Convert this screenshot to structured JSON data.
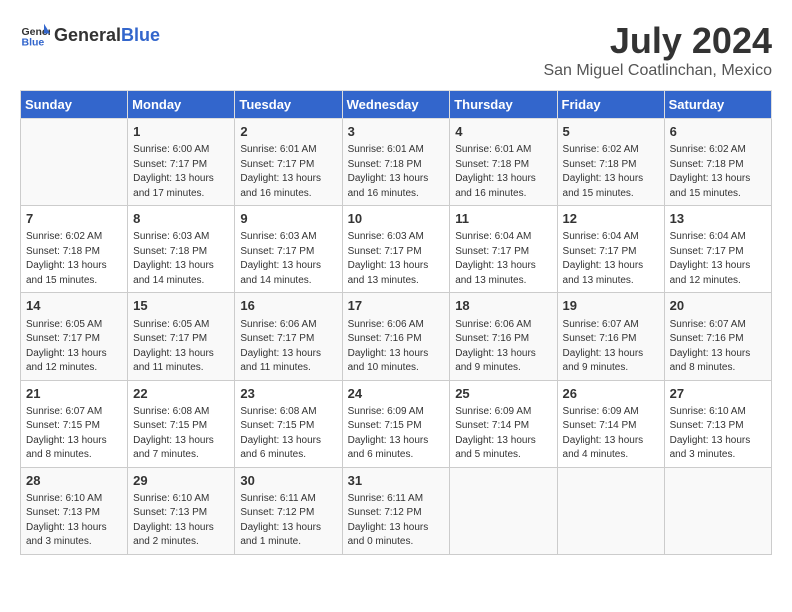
{
  "header": {
    "logo_general": "General",
    "logo_blue": "Blue",
    "title": "July 2024",
    "subtitle": "San Miguel Coatlinchan, Mexico"
  },
  "days_of_week": [
    "Sunday",
    "Monday",
    "Tuesday",
    "Wednesday",
    "Thursday",
    "Friday",
    "Saturday"
  ],
  "weeks": [
    [
      {
        "day": "",
        "sunrise": "",
        "sunset": "",
        "daylight": ""
      },
      {
        "day": "1",
        "sunrise": "Sunrise: 6:00 AM",
        "sunset": "Sunset: 7:17 PM",
        "daylight": "Daylight: 13 hours and 17 minutes."
      },
      {
        "day": "2",
        "sunrise": "Sunrise: 6:01 AM",
        "sunset": "Sunset: 7:17 PM",
        "daylight": "Daylight: 13 hours and 16 minutes."
      },
      {
        "day": "3",
        "sunrise": "Sunrise: 6:01 AM",
        "sunset": "Sunset: 7:18 PM",
        "daylight": "Daylight: 13 hours and 16 minutes."
      },
      {
        "day": "4",
        "sunrise": "Sunrise: 6:01 AM",
        "sunset": "Sunset: 7:18 PM",
        "daylight": "Daylight: 13 hours and 16 minutes."
      },
      {
        "day": "5",
        "sunrise": "Sunrise: 6:02 AM",
        "sunset": "Sunset: 7:18 PM",
        "daylight": "Daylight: 13 hours and 15 minutes."
      },
      {
        "day": "6",
        "sunrise": "Sunrise: 6:02 AM",
        "sunset": "Sunset: 7:18 PM",
        "daylight": "Daylight: 13 hours and 15 minutes."
      }
    ],
    [
      {
        "day": "7",
        "sunrise": "Sunrise: 6:02 AM",
        "sunset": "Sunset: 7:18 PM",
        "daylight": "Daylight: 13 hours and 15 minutes."
      },
      {
        "day": "8",
        "sunrise": "Sunrise: 6:03 AM",
        "sunset": "Sunset: 7:18 PM",
        "daylight": "Daylight: 13 hours and 14 minutes."
      },
      {
        "day": "9",
        "sunrise": "Sunrise: 6:03 AM",
        "sunset": "Sunset: 7:17 PM",
        "daylight": "Daylight: 13 hours and 14 minutes."
      },
      {
        "day": "10",
        "sunrise": "Sunrise: 6:03 AM",
        "sunset": "Sunset: 7:17 PM",
        "daylight": "Daylight: 13 hours and 13 minutes."
      },
      {
        "day": "11",
        "sunrise": "Sunrise: 6:04 AM",
        "sunset": "Sunset: 7:17 PM",
        "daylight": "Daylight: 13 hours and 13 minutes."
      },
      {
        "day": "12",
        "sunrise": "Sunrise: 6:04 AM",
        "sunset": "Sunset: 7:17 PM",
        "daylight": "Daylight: 13 hours and 13 minutes."
      },
      {
        "day": "13",
        "sunrise": "Sunrise: 6:04 AM",
        "sunset": "Sunset: 7:17 PM",
        "daylight": "Daylight: 13 hours and 12 minutes."
      }
    ],
    [
      {
        "day": "14",
        "sunrise": "Sunrise: 6:05 AM",
        "sunset": "Sunset: 7:17 PM",
        "daylight": "Daylight: 13 hours and 12 minutes."
      },
      {
        "day": "15",
        "sunrise": "Sunrise: 6:05 AM",
        "sunset": "Sunset: 7:17 PM",
        "daylight": "Daylight: 13 hours and 11 minutes."
      },
      {
        "day": "16",
        "sunrise": "Sunrise: 6:06 AM",
        "sunset": "Sunset: 7:17 PM",
        "daylight": "Daylight: 13 hours and 11 minutes."
      },
      {
        "day": "17",
        "sunrise": "Sunrise: 6:06 AM",
        "sunset": "Sunset: 7:16 PM",
        "daylight": "Daylight: 13 hours and 10 minutes."
      },
      {
        "day": "18",
        "sunrise": "Sunrise: 6:06 AM",
        "sunset": "Sunset: 7:16 PM",
        "daylight": "Daylight: 13 hours and 9 minutes."
      },
      {
        "day": "19",
        "sunrise": "Sunrise: 6:07 AM",
        "sunset": "Sunset: 7:16 PM",
        "daylight": "Daylight: 13 hours and 9 minutes."
      },
      {
        "day": "20",
        "sunrise": "Sunrise: 6:07 AM",
        "sunset": "Sunset: 7:16 PM",
        "daylight": "Daylight: 13 hours and 8 minutes."
      }
    ],
    [
      {
        "day": "21",
        "sunrise": "Sunrise: 6:07 AM",
        "sunset": "Sunset: 7:15 PM",
        "daylight": "Daylight: 13 hours and 8 minutes."
      },
      {
        "day": "22",
        "sunrise": "Sunrise: 6:08 AM",
        "sunset": "Sunset: 7:15 PM",
        "daylight": "Daylight: 13 hours and 7 minutes."
      },
      {
        "day": "23",
        "sunrise": "Sunrise: 6:08 AM",
        "sunset": "Sunset: 7:15 PM",
        "daylight": "Daylight: 13 hours and 6 minutes."
      },
      {
        "day": "24",
        "sunrise": "Sunrise: 6:09 AM",
        "sunset": "Sunset: 7:15 PM",
        "daylight": "Daylight: 13 hours and 6 minutes."
      },
      {
        "day": "25",
        "sunrise": "Sunrise: 6:09 AM",
        "sunset": "Sunset: 7:14 PM",
        "daylight": "Daylight: 13 hours and 5 minutes."
      },
      {
        "day": "26",
        "sunrise": "Sunrise: 6:09 AM",
        "sunset": "Sunset: 7:14 PM",
        "daylight": "Daylight: 13 hours and 4 minutes."
      },
      {
        "day": "27",
        "sunrise": "Sunrise: 6:10 AM",
        "sunset": "Sunset: 7:13 PM",
        "daylight": "Daylight: 13 hours and 3 minutes."
      }
    ],
    [
      {
        "day": "28",
        "sunrise": "Sunrise: 6:10 AM",
        "sunset": "Sunset: 7:13 PM",
        "daylight": "Daylight: 13 hours and 3 minutes."
      },
      {
        "day": "29",
        "sunrise": "Sunrise: 6:10 AM",
        "sunset": "Sunset: 7:13 PM",
        "daylight": "Daylight: 13 hours and 2 minutes."
      },
      {
        "day": "30",
        "sunrise": "Sunrise: 6:11 AM",
        "sunset": "Sunset: 7:12 PM",
        "daylight": "Daylight: 13 hours and 1 minute."
      },
      {
        "day": "31",
        "sunrise": "Sunrise: 6:11 AM",
        "sunset": "Sunset: 7:12 PM",
        "daylight": "Daylight: 13 hours and 0 minutes."
      },
      {
        "day": "",
        "sunrise": "",
        "sunset": "",
        "daylight": ""
      },
      {
        "day": "",
        "sunrise": "",
        "sunset": "",
        "daylight": ""
      },
      {
        "day": "",
        "sunrise": "",
        "sunset": "",
        "daylight": ""
      }
    ]
  ]
}
